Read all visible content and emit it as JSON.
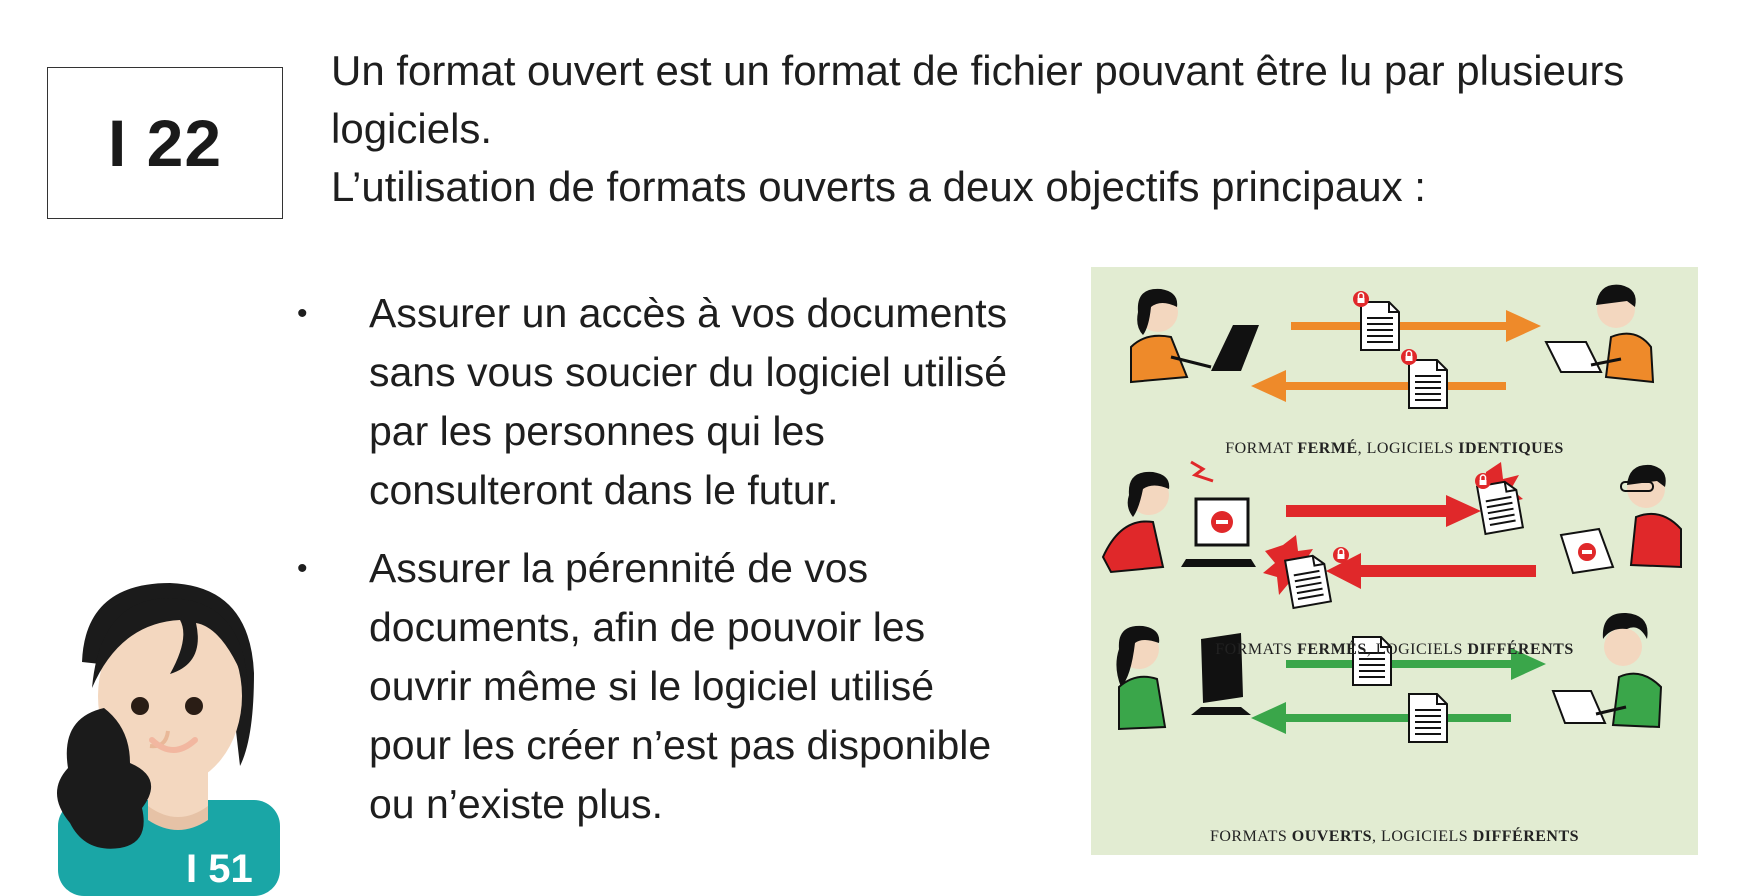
{
  "code": "I 22",
  "intro": {
    "line1": "Un format ouvert est un format de fichier pouvant être lu par plusieurs",
    "line2": "logiciels.",
    "line3": "L’utilisation de formats ouverts a deux objectifs principaux :"
  },
  "bullets": [
    {
      "marker": "•",
      "lines": [
        "Assurer un accès à vos documents",
        "sans vous soucier du logiciel utilisé",
        "par les personnes qui les",
        "consulteront dans le futur."
      ]
    },
    {
      "marker": "•",
      "lines": [
        "Assurer la pérennité de vos",
        "documents, afin de pouvoir les",
        "ouvrir même si le logiciel utilisé",
        "pour les créer n’est pas disponible",
        "ou n’existe plus."
      ]
    }
  ],
  "avatar_code": "I 51",
  "illustration": {
    "captions": [
      {
        "p1": "FORMAT ",
        "b1": "FERMÉ",
        "p2": ", LOGICIELS ",
        "b2": "IDENTIQUES"
      },
      {
        "p1": "FORMATS ",
        "b1": "FERMÉS",
        "p2": ", LOGICIELS ",
        "b2": "DIFFÉRENTS"
      },
      {
        "p1": "FORMATS ",
        "b1": "OUVERTS",
        "p2": ", LOGICIELS ",
        "b2": "DIFFÉRENTS"
      }
    ]
  },
  "colors": {
    "orange": "#ee8a2a",
    "red": "#e0282a",
    "green": "#3aa64a",
    "panel_bg": "#e2ecd2",
    "avatar_shirt": "#1aa6a6"
  }
}
